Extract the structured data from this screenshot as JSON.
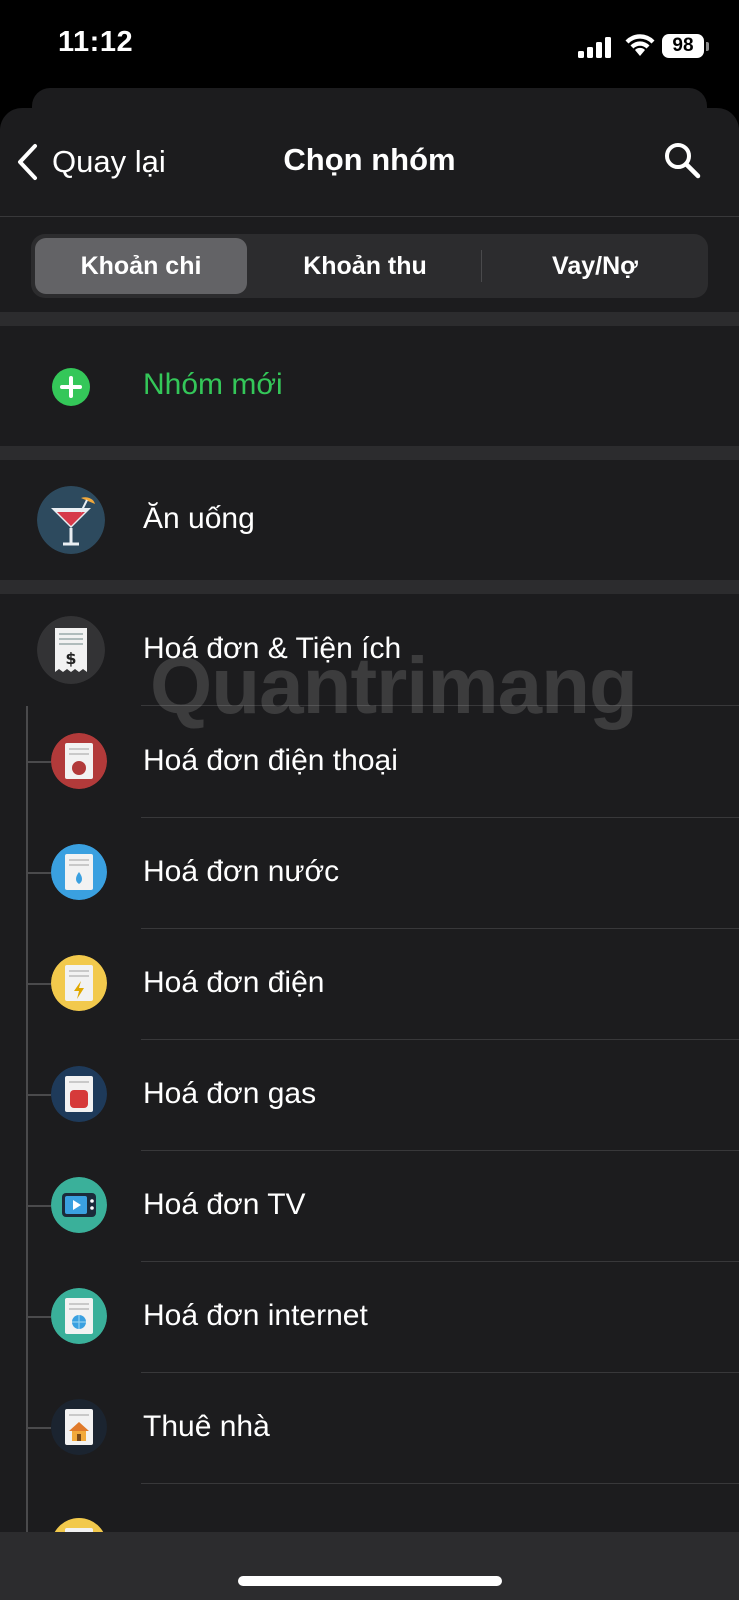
{
  "status": {
    "time": "11:12",
    "battery": "98"
  },
  "nav": {
    "back_label": "Quay lại",
    "title": "Chọn nhóm"
  },
  "tabs": [
    {
      "label": "Khoản chi",
      "active": true
    },
    {
      "label": "Khoản thu",
      "active": false
    },
    {
      "label": "Vay/Nợ",
      "active": false
    }
  ],
  "new_group": {
    "label": "Nhóm mới",
    "color": "#34c759"
  },
  "groups": [
    {
      "label": "Ăn uống",
      "icon": "cocktail-icon"
    },
    {
      "label": "Hoá đơn & Tiện ích",
      "icon": "bill-dollar-icon"
    }
  ],
  "subgroups": [
    {
      "label": "Hoá đơn điện thoại",
      "icon": "phone-bill-icon",
      "color": "#b23a3a"
    },
    {
      "label": "Hoá đơn nước",
      "icon": "water-bill-icon",
      "color": "#3aa0e0"
    },
    {
      "label": "Hoá đơn điện",
      "icon": "electric-bill-icon",
      "color": "#f2c94c"
    },
    {
      "label": "Hoá đơn gas",
      "icon": "gas-bill-icon",
      "color": "#1e3a5a"
    },
    {
      "label": "Hoá đơn TV",
      "icon": "tv-bill-icon",
      "color": "#3ab09a"
    },
    {
      "label": "Hoá đơn internet",
      "icon": "internet-bill-icon",
      "color": "#3ab09a"
    },
    {
      "label": "Thuê nhà",
      "icon": "house-rent-icon",
      "color": "#1b2430"
    }
  ],
  "watermark": "Quantrimang"
}
